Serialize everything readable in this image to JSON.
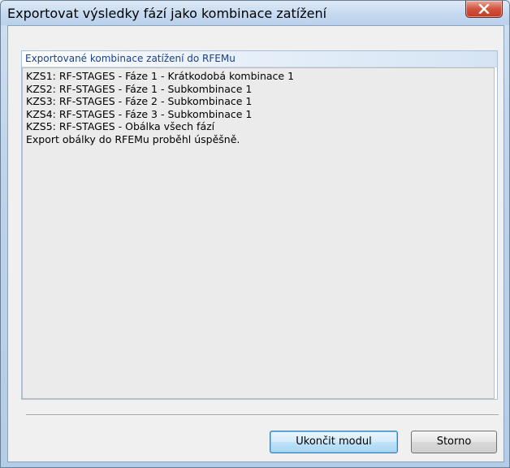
{
  "window": {
    "title": "Exportovat výsledky fází jako kombinace zatížení",
    "close_icon": "close-icon"
  },
  "group": {
    "title": "Exportované kombinace zatížení do RFEMu",
    "lines": [
      "KZS1: RF-STAGES - Fáze 1 - Krátkodobá kombinace 1",
      "KZS2: RF-STAGES - Fáze 1 - Subkombinace 1",
      "KZS3: RF-STAGES - Fáze 2 - Subkombinace 1",
      "KZS4: RF-STAGES - Fáze 3 - Subkombinace 1",
      "KZS5: RF-STAGES - Obálka všech fází",
      "Export obálky do RFEMu proběhl úspěšně."
    ]
  },
  "buttons": {
    "finish_label": "Ukončit modul",
    "cancel_label": "Storno"
  }
}
